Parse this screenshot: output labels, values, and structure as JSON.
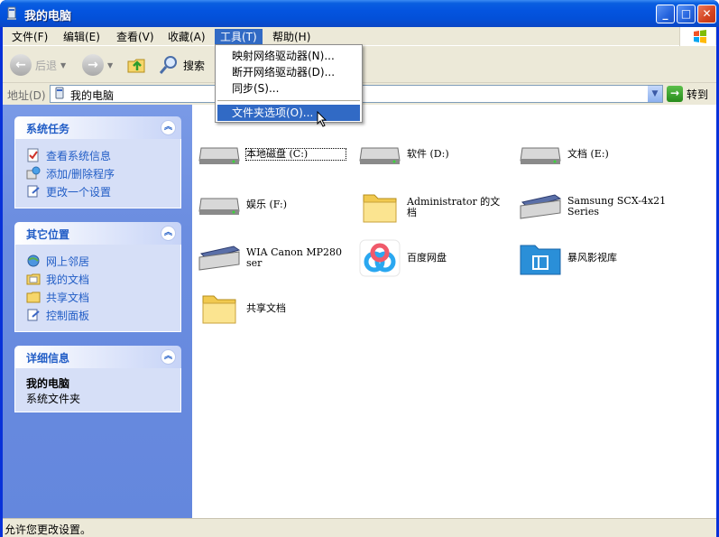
{
  "window": {
    "title": "我的电脑"
  },
  "menubar": {
    "items": [
      {
        "label": "文件(F)"
      },
      {
        "label": "编辑(E)"
      },
      {
        "label": "查看(V)"
      },
      {
        "label": "收藏(A)"
      },
      {
        "label": "工具(T)"
      },
      {
        "label": "帮助(H)"
      }
    ]
  },
  "toolbar": {
    "back": "后退",
    "search": "搜索"
  },
  "address": {
    "label": "地址(D)",
    "value": "我的电脑",
    "go": "转到"
  },
  "tools_menu": {
    "items": [
      {
        "label": "映射网络驱动器(N)..."
      },
      {
        "label": "断开网络驱动器(D)..."
      },
      {
        "label": "同步(S)..."
      },
      {
        "label": "文件夹选项(O)..."
      }
    ]
  },
  "left_panel": {
    "system_tasks": {
      "title": "系统任务",
      "links": [
        "查看系统信息",
        "添加/删除程序",
        "更改一个设置"
      ]
    },
    "other_places": {
      "title": "其它位置",
      "links": [
        "网上邻居",
        "我的文档",
        "共享文档",
        "控制面板"
      ]
    },
    "details": {
      "title": "详细信息",
      "name": "我的电脑",
      "type": "系统文件夹"
    }
  },
  "content": {
    "items": [
      {
        "label": "本地磁盘 (C:)",
        "icon": "hard-drive-icon"
      },
      {
        "label": "软件 (D:)",
        "icon": "hard-drive-icon"
      },
      {
        "label": "文档 (E:)",
        "icon": "hard-drive-icon"
      },
      {
        "label": "娱乐 (F:)",
        "icon": "hard-drive-icon"
      },
      {
        "label": "Administrator 的文档",
        "icon": "folder-icon"
      },
      {
        "label": "Samsung SCX-4x21 Series",
        "icon": "scanner-icon"
      },
      {
        "label": "WIA Canon MP280 ser",
        "icon": "scanner-icon"
      },
      {
        "label": "百度网盘",
        "icon": "baidu-netdisk-icon"
      },
      {
        "label": "暴风影视库",
        "icon": "video-library-icon"
      },
      {
        "label": "共享文档",
        "icon": "folder-icon"
      }
    ]
  },
  "statusbar": {
    "text": "允许您更改设置。"
  },
  "colors": {
    "title_bar": "#0454df",
    "menu_highlight": "#316ac5",
    "panel_link": "#215dc6"
  }
}
